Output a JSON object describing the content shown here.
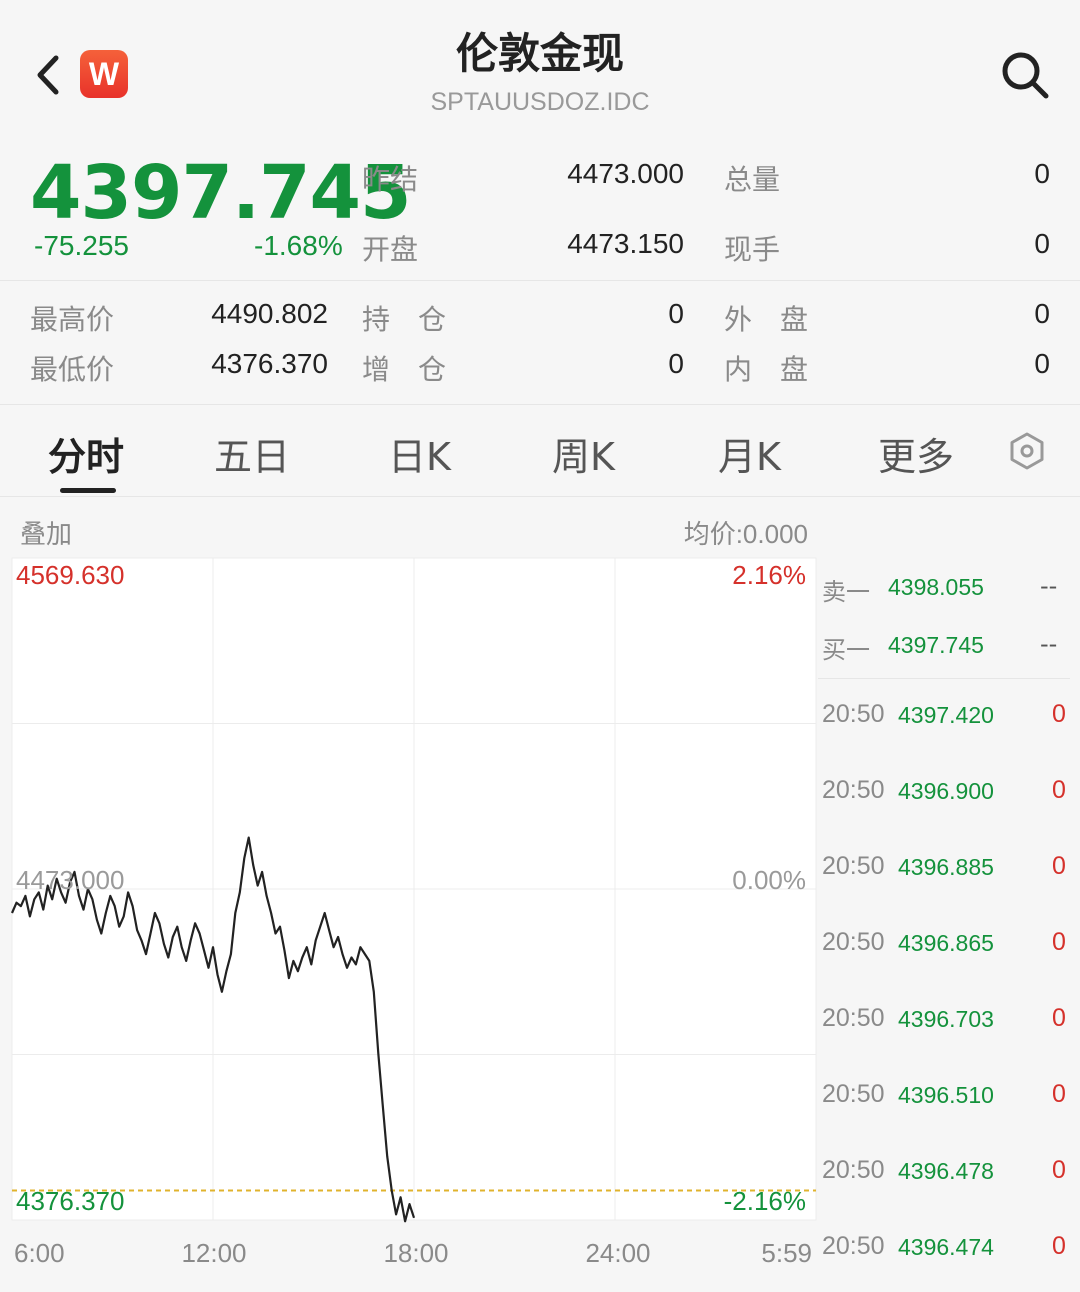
{
  "header": {
    "title": "伦敦金现",
    "code": "SPTAUUSDOZ.IDC",
    "logo_text": "W"
  },
  "quote": {
    "price": "4397.745",
    "change": "-75.255",
    "change_pct": "-1.68%",
    "stats": [
      {
        "label": "昨结",
        "value": "4473.000"
      },
      {
        "label": "总量",
        "value": "0"
      },
      {
        "label": "开盘",
        "value": "4473.150"
      },
      {
        "label": "现手",
        "value": "0"
      },
      {
        "label": "最高价",
        "value": "4490.802"
      },
      {
        "label": "持　仓",
        "value": "0"
      },
      {
        "label": "外　盘",
        "value": "0"
      },
      {
        "label": "最低价",
        "value": "4376.370"
      },
      {
        "label": "增　仓",
        "value": "0"
      },
      {
        "label": "内　盘",
        "value": "0"
      }
    ]
  },
  "tabs": [
    "分时",
    "五日",
    "日K",
    "周K",
    "月K",
    "更多"
  ],
  "chart_header": {
    "overlay_label": "叠加",
    "avg_price": "均价:0.000"
  },
  "colors": {
    "up": "#d5312b",
    "down": "#14923c",
    "grid": "#ececec",
    "avg_line": "#e0b32d"
  },
  "chart_data": {
    "type": "line",
    "ylim": [
      4376.37,
      4569.63
    ],
    "reference": 4473.0,
    "y_labels_left": [
      "4569.630",
      "4473.000",
      "4376.370"
    ],
    "y_labels_right": [
      "2.16%",
      "0.00%",
      "-2.16%"
    ],
    "x_ticks": [
      "6:00",
      "12:00",
      "18:00",
      "24:00",
      "5:59"
    ],
    "avg_price": 4385,
    "series": [
      {
        "values": [
          4466,
          4469,
          4468,
          4471,
          4465,
          4470,
          4472,
          4467,
          4474,
          4470,
          4476,
          4472,
          4469,
          4475,
          4478,
          4471,
          4467,
          4473,
          4470,
          4464,
          4460,
          4466,
          4471,
          4468,
          4462,
          4465,
          4472,
          4468,
          4461,
          4458,
          4454,
          4460,
          4466,
          4463,
          4457,
          4453,
          4459,
          4462,
          4456,
          4452,
          4458,
          4463,
          4460,
          4455,
          4450,
          4456,
          4448,
          4443,
          4449,
          4454,
          4466,
          4472,
          4482,
          4488,
          4480,
          4474,
          4478,
          4471,
          4466,
          4460,
          4462,
          4455,
          4447,
          4452,
          4449,
          4453,
          4456,
          4451,
          4458,
          4462,
          4466,
          4461,
          4456,
          4459,
          4454,
          4450,
          4453,
          4451,
          4456,
          4454,
          4452,
          4443,
          4425,
          4410,
          4395,
          4385,
          4378,
          4383,
          4376,
          4381,
          4377
        ]
      }
    ],
    "bid_ask": [
      {
        "label": "卖一",
        "price": "4398.055",
        "vol": "--"
      },
      {
        "label": "买一",
        "price": "4397.745",
        "vol": "--"
      }
    ],
    "trades": [
      {
        "time": "20:50",
        "price": "4397.420",
        "vol": "0"
      },
      {
        "time": "20:50",
        "price": "4396.900",
        "vol": "0"
      },
      {
        "time": "20:50",
        "price": "4396.885",
        "vol": "0"
      },
      {
        "time": "20:50",
        "price": "4396.865",
        "vol": "0"
      },
      {
        "time": "20:50",
        "price": "4396.703",
        "vol": "0"
      },
      {
        "time": "20:50",
        "price": "4396.510",
        "vol": "0"
      },
      {
        "time": "20:50",
        "price": "4396.478",
        "vol": "0"
      },
      {
        "time": "20:50",
        "price": "4396.474",
        "vol": "0"
      }
    ]
  }
}
